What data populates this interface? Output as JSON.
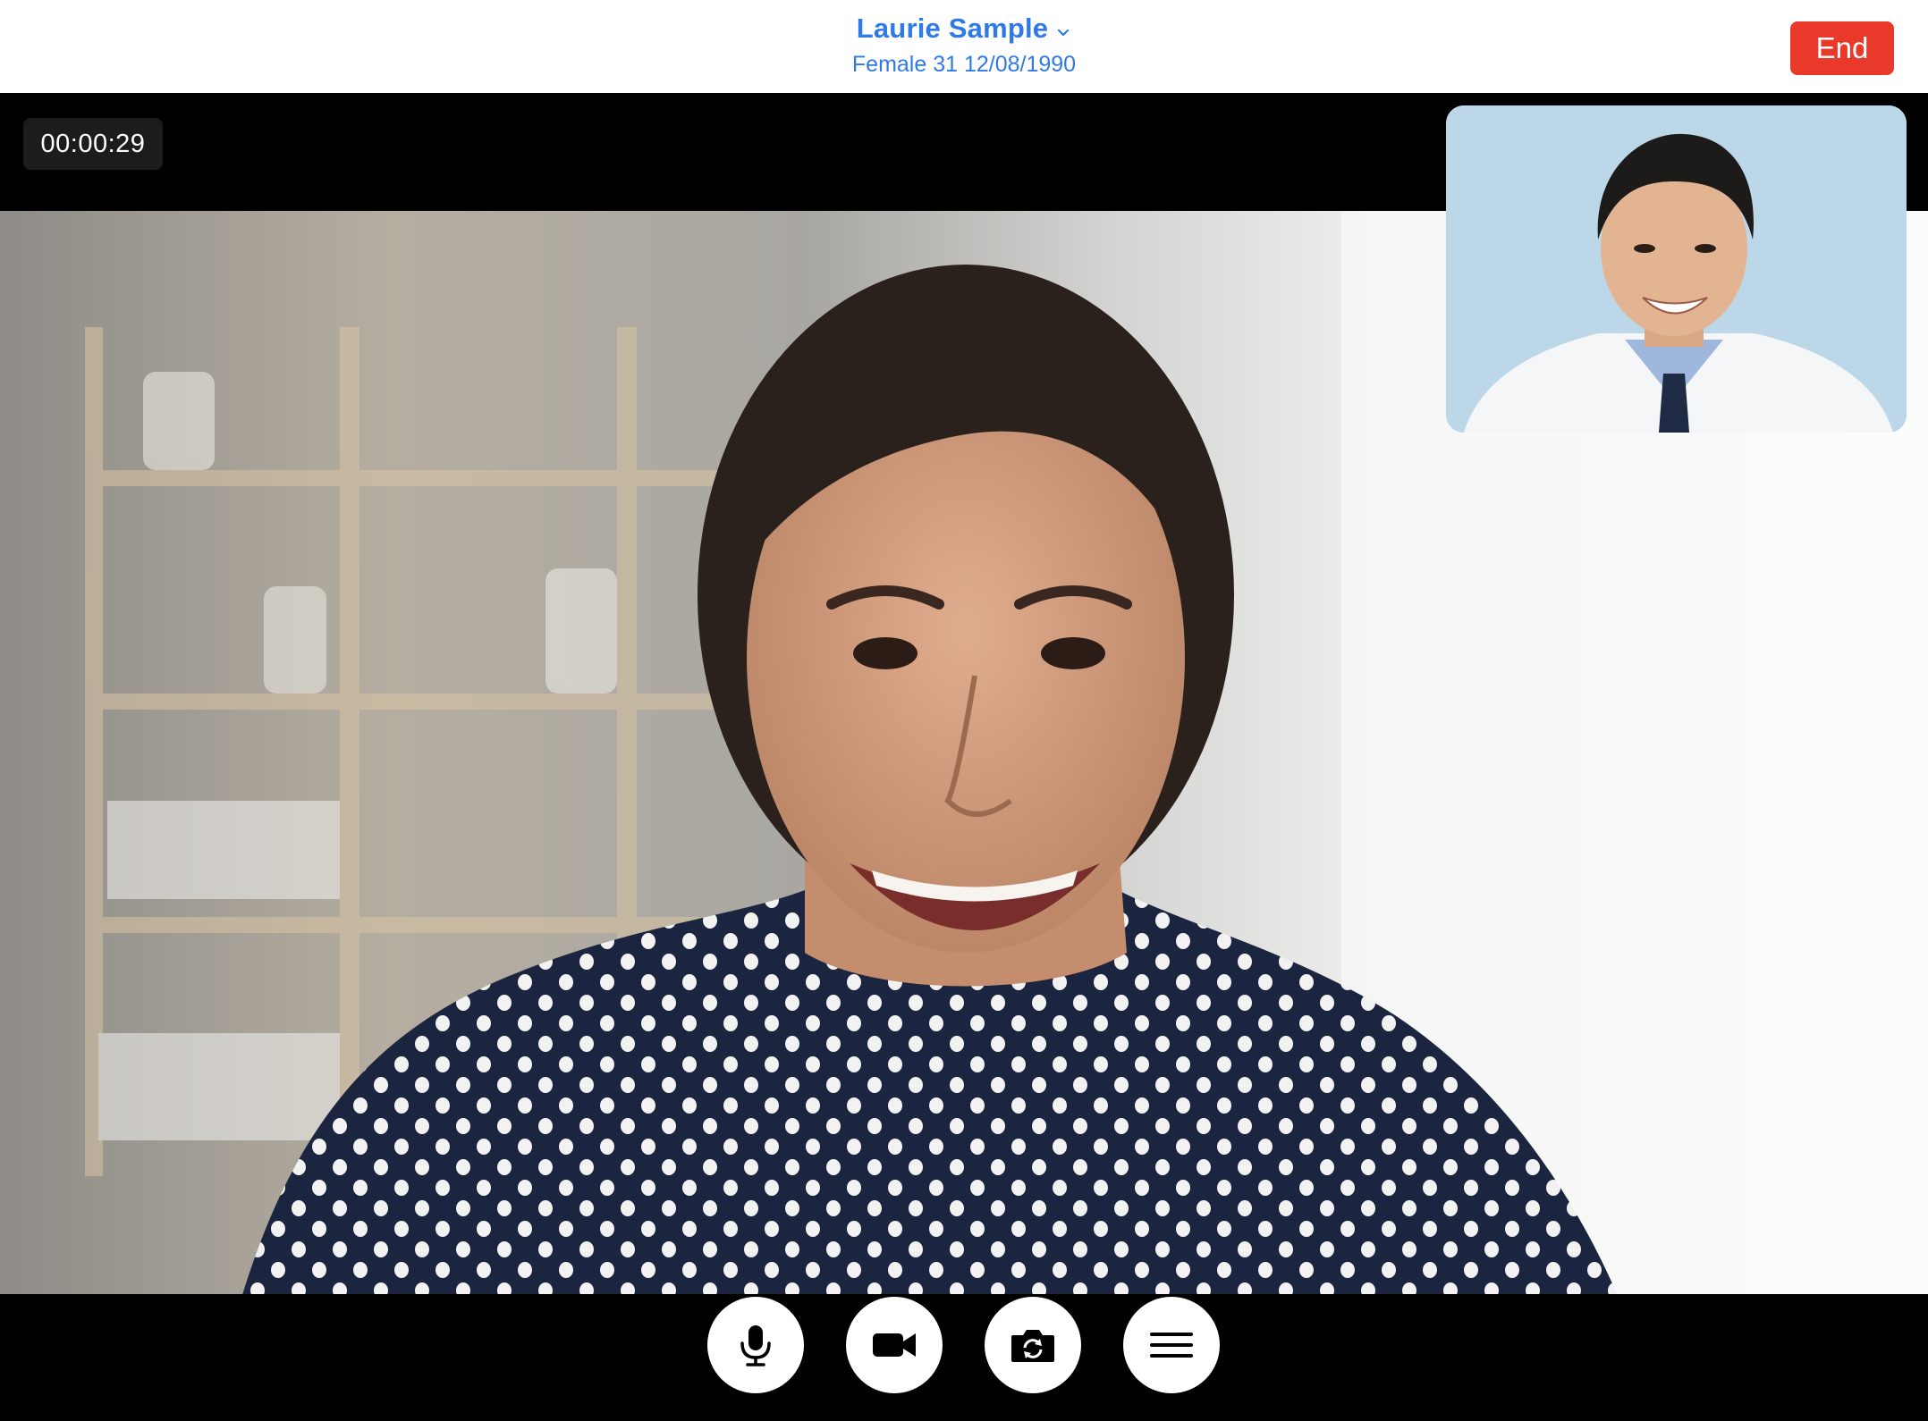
{
  "header": {
    "patient_name": "Laurie Sample",
    "patient_details": "Female 31 12/08/1990",
    "end_label": "End"
  },
  "call": {
    "timer": "00:00:29"
  },
  "controls": [
    {
      "icon": "microphone-icon"
    },
    {
      "icon": "video-camera-icon"
    },
    {
      "icon": "switch-camera-icon"
    },
    {
      "icon": "menu-icon"
    }
  ],
  "colors": {
    "accent": "#2f7ae5",
    "end_button": "#e8392b",
    "background": "#000000"
  }
}
